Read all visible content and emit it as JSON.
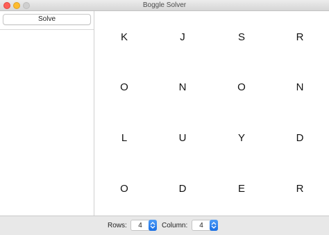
{
  "window": {
    "title": "Boggle Solver",
    "buttons": [
      "close",
      "minimize",
      "zoom"
    ]
  },
  "sidebar": {
    "solve_label": "Solve"
  },
  "board": {
    "rows": [
      [
        "K",
        "J",
        "S",
        "R"
      ],
      [
        "O",
        "N",
        "O",
        "N"
      ],
      [
        "L",
        "U",
        "Y",
        "D"
      ],
      [
        "O",
        "D",
        "E",
        "R"
      ]
    ]
  },
  "bottombar": {
    "rows_label": "Rows:",
    "rows_value": "4",
    "column_label": "Column:",
    "column_value": "4"
  },
  "colors": {
    "close": "#fe5f57",
    "minimize": "#febc2e",
    "stepper_accent": "#2a7ff0"
  },
  "icons": [
    "close-button-icon",
    "minimize-button-icon",
    "zoom-button-icon",
    "stepper-arrows-icon"
  ]
}
